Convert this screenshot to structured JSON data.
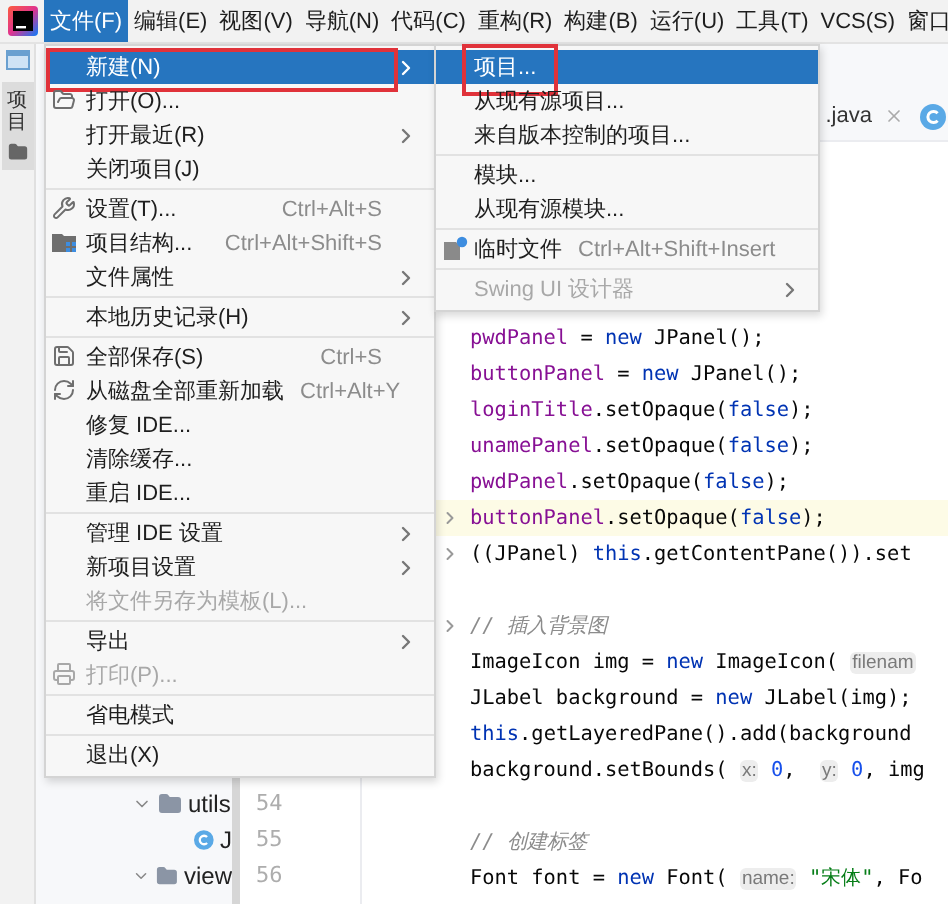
{
  "menu_bar": {
    "items": [
      {
        "label": "文件(F)",
        "selected": true
      },
      {
        "label": "编辑(E)",
        "selected": false
      },
      {
        "label": "视图(V)",
        "selected": false
      },
      {
        "label": "导航(N)",
        "selected": false
      },
      {
        "label": "代码(C)",
        "selected": false
      },
      {
        "label": "重构(R)",
        "selected": false
      },
      {
        "label": "构建(B)",
        "selected": false
      },
      {
        "label": "运行(U)",
        "selected": false
      },
      {
        "label": "工具(T)",
        "selected": false
      },
      {
        "label": "VCS(S)",
        "selected": false
      },
      {
        "label": "窗口",
        "selected": false
      }
    ]
  },
  "sidebar_tab": {
    "label": "项目"
  },
  "project_tree": {
    "items": [
      {
        "label": "utils",
        "kind": "folder",
        "expanded": true,
        "children": [
          {
            "label": "J",
            "kind": "class",
            "expanded": false
          }
        ]
      },
      {
        "label": "view",
        "kind": "folder",
        "expanded": true
      }
    ]
  },
  "line_numbers": [
    "54",
    "55",
    "56"
  ],
  "editor": {
    "tab": {
      "label": ".java"
    },
    "code_blocks": [
      [
        {
          "highlighted": false,
          "fold_marker": false,
          "tokens": [
            {
              "kind": "field",
              "text": "pwdPanel"
            },
            {
              "kind": "plain",
              "text": " = "
            },
            {
              "kind": "keyword",
              "text": "new"
            },
            {
              "kind": "plain",
              "text": " JPanel();"
            }
          ]
        },
        {
          "highlighted": false,
          "fold_marker": false,
          "tokens": [
            {
              "kind": "field",
              "text": "buttonPanel"
            },
            {
              "kind": "plain",
              "text": " = "
            },
            {
              "kind": "keyword",
              "text": "new"
            },
            {
              "kind": "plain",
              "text": " JPanel();"
            }
          ]
        },
        {
          "highlighted": false,
          "fold_marker": false,
          "tokens": [
            {
              "kind": "field",
              "text": "loginTitle"
            },
            {
              "kind": "plain",
              "text": ".setOpaque("
            },
            {
              "kind": "keyword",
              "text": "false"
            },
            {
              "kind": "plain",
              "text": ");"
            }
          ]
        },
        {
          "highlighted": false,
          "fold_marker": false,
          "tokens": [
            {
              "kind": "field",
              "text": "unamePanel"
            },
            {
              "kind": "plain",
              "text": ".setOpaque("
            },
            {
              "kind": "keyword",
              "text": "false"
            },
            {
              "kind": "plain",
              "text": ");"
            }
          ]
        },
        {
          "highlighted": false,
          "fold_marker": false,
          "tokens": [
            {
              "kind": "field",
              "text": "pwdPanel"
            },
            {
              "kind": "plain",
              "text": ".setOpaque("
            },
            {
              "kind": "keyword",
              "text": "false"
            },
            {
              "kind": "plain",
              "text": ");"
            }
          ]
        },
        {
          "highlighted": true,
          "fold_marker": true,
          "tokens": [
            {
              "kind": "field",
              "text": "buttonPanel"
            },
            {
              "kind": "plain",
              "text": ".setOpaque("
            },
            {
              "kind": "keyword",
              "text": "false"
            },
            {
              "kind": "plain",
              "text": ");"
            }
          ]
        },
        {
          "highlighted": false,
          "fold_marker": true,
          "tokens": [
            {
              "kind": "plain",
              "text": "((JPanel) "
            },
            {
              "kind": "keyword",
              "text": "this"
            },
            {
              "kind": "plain",
              "text": ".getContentPane()).set"
            }
          ]
        }
      ],
      [
        {
          "highlighted": false,
          "fold_marker": true,
          "tokens": [
            {
              "kind": "comment",
              "text": "// 插入背景图"
            }
          ]
        },
        {
          "highlighted": false,
          "fold_marker": false,
          "tokens": [
            {
              "kind": "plain",
              "text": "ImageIcon img = "
            },
            {
              "kind": "keyword",
              "text": "new"
            },
            {
              "kind": "plain",
              "text": " ImageIcon( "
            },
            {
              "kind": "hint",
              "text": "filenam"
            }
          ]
        },
        {
          "highlighted": false,
          "fold_marker": false,
          "tokens": [
            {
              "kind": "plain",
              "text": "JLabel background = "
            },
            {
              "kind": "keyword",
              "text": "new"
            },
            {
              "kind": "plain",
              "text": " JLabel(img);"
            }
          ]
        },
        {
          "highlighted": false,
          "fold_marker": false,
          "tokens": [
            {
              "kind": "keyword",
              "text": "this"
            },
            {
              "kind": "plain",
              "text": ".getLayeredPane().add(background"
            }
          ]
        },
        {
          "highlighted": false,
          "fold_marker": false,
          "tokens": [
            {
              "kind": "plain",
              "text": "background.setBounds( "
            },
            {
              "kind": "hint",
              "text": "x:"
            },
            {
              "kind": "number",
              "text": " 0"
            },
            {
              "kind": "plain",
              "text": ",  "
            },
            {
              "kind": "hint",
              "text": "y:"
            },
            {
              "kind": "number",
              "text": " 0"
            },
            {
              "kind": "plain",
              "text": ", img"
            }
          ]
        }
      ],
      [
        {
          "highlighted": false,
          "fold_marker": false,
          "tokens": [
            {
              "kind": "comment",
              "text": "// 创建标签"
            }
          ]
        },
        {
          "highlighted": false,
          "fold_marker": false,
          "tokens": [
            {
              "kind": "plain",
              "text": "Font font = "
            },
            {
              "kind": "keyword",
              "text": "new"
            },
            {
              "kind": "plain",
              "text": " Font( "
            },
            {
              "kind": "hint",
              "text": "name:"
            },
            {
              "kind": "string",
              "text": " \"宋体\""
            },
            {
              "kind": "plain",
              "text": ", Fo"
            }
          ]
        }
      ]
    ]
  },
  "file_menu": {
    "groups": [
      [
        {
          "label": "新建(N)",
          "selected": true,
          "submenu": true,
          "disabled": false,
          "annotated": true
        },
        {
          "label": "打开(O)...",
          "selected": false,
          "submenu": false,
          "disabled": false,
          "annotated": false
        },
        {
          "label": "打开最近(R)",
          "selected": false,
          "submenu": true,
          "disabled": false,
          "annotated": false
        },
        {
          "label": "关闭项目(J)",
          "selected": false,
          "submenu": false,
          "disabled": false,
          "annotated": false
        }
      ],
      [
        {
          "label": "设置(T)...",
          "shortcut": "Ctrl+Alt+S",
          "selected": false,
          "submenu": false,
          "disabled": false,
          "annotated": false
        },
        {
          "label": "项目结构...",
          "shortcut": "Ctrl+Alt+Shift+S",
          "selected": false,
          "submenu": false,
          "disabled": false,
          "annotated": false
        },
        {
          "label": "文件属性",
          "selected": false,
          "submenu": true,
          "disabled": false,
          "annotated": false
        }
      ],
      [
        {
          "label": "本地历史记录(H)",
          "selected": false,
          "submenu": true,
          "disabled": false,
          "annotated": false
        }
      ],
      [
        {
          "label": "全部保存(S)",
          "shortcut": "Ctrl+S",
          "selected": false,
          "submenu": false,
          "disabled": false,
          "annotated": false
        },
        {
          "label": "从磁盘全部重新加载",
          "shortcut": "Ctrl+Alt+Y",
          "selected": false,
          "submenu": false,
          "disabled": false,
          "annotated": false
        },
        {
          "label": "修复 IDE...",
          "selected": false,
          "submenu": false,
          "disabled": false,
          "annotated": false
        },
        {
          "label": "清除缓存...",
          "selected": false,
          "submenu": false,
          "disabled": false,
          "annotated": false
        },
        {
          "label": "重启 IDE...",
          "selected": false,
          "submenu": false,
          "disabled": false,
          "annotated": false
        }
      ],
      [
        {
          "label": "管理 IDE 设置",
          "selected": false,
          "submenu": true,
          "disabled": false,
          "annotated": false
        },
        {
          "label": "新项目设置",
          "selected": false,
          "submenu": true,
          "disabled": false,
          "annotated": false
        },
        {
          "label": "将文件另存为模板(L)...",
          "selected": false,
          "submenu": false,
          "disabled": true,
          "annotated": false
        }
      ],
      [
        {
          "label": "导出",
          "selected": false,
          "submenu": true,
          "disabled": false,
          "annotated": false
        },
        {
          "label": "打印(P)...",
          "selected": false,
          "submenu": false,
          "disabled": true,
          "annotated": false
        }
      ],
      [
        {
          "label": "省电模式",
          "selected": false,
          "submenu": false,
          "disabled": false,
          "annotated": false
        }
      ],
      [
        {
          "label": "退出(X)",
          "selected": false,
          "submenu": false,
          "disabled": false,
          "annotated": false
        }
      ]
    ]
  },
  "new_submenu": {
    "groups": [
      [
        {
          "label": "项目...",
          "selected": true,
          "submenu": false,
          "disabled": false,
          "annotated": true
        },
        {
          "label": "从现有源项目...",
          "selected": false,
          "submenu": false,
          "disabled": false,
          "annotated": false
        },
        {
          "label": "来自版本控制的项目...",
          "selected": false,
          "submenu": false,
          "disabled": false,
          "annotated": false
        }
      ],
      [
        {
          "label": "模块...",
          "selected": false,
          "submenu": false,
          "disabled": false,
          "annotated": false
        },
        {
          "label": "从现有源模块...",
          "selected": false,
          "submenu": false,
          "disabled": false,
          "annotated": false
        }
      ],
      [
        {
          "label": "临时文件",
          "shortcut": "Ctrl+Alt+Shift+Insert",
          "selected": false,
          "submenu": false,
          "disabled": false,
          "annotated": false
        }
      ],
      [
        {
          "label": "Swing UI 设计器",
          "selected": false,
          "submenu": true,
          "disabled": true,
          "annotated": false
        }
      ]
    ]
  }
}
